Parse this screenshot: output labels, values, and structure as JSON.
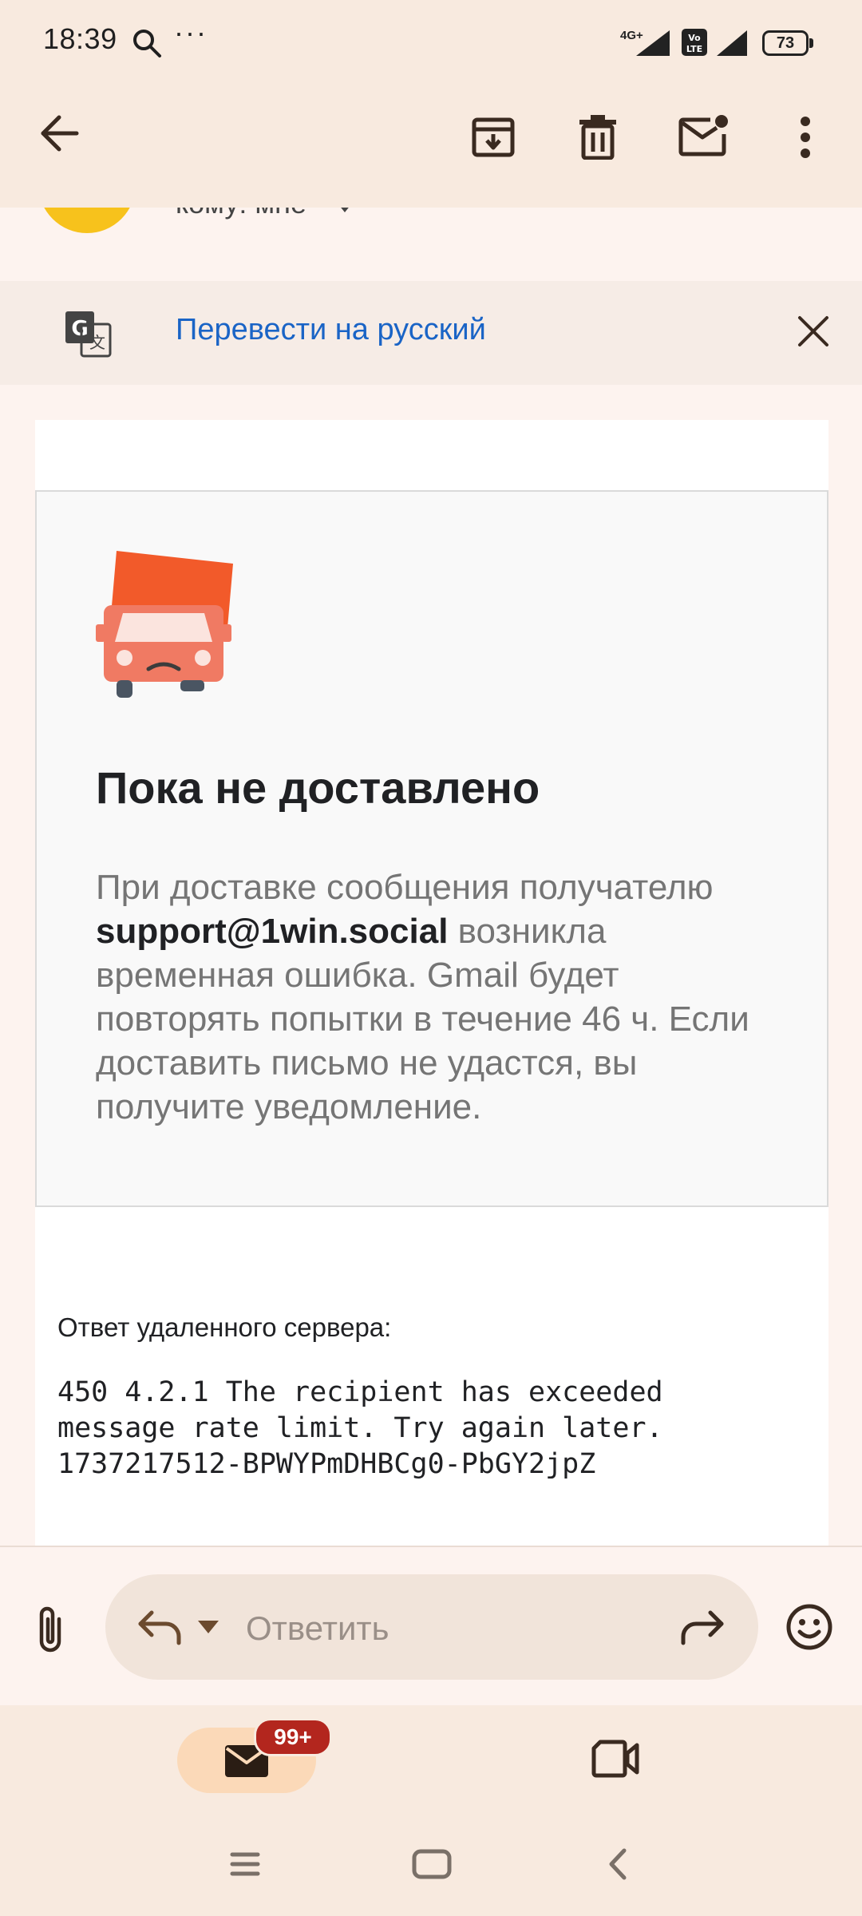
{
  "status_bar": {
    "time": "18:39",
    "dots": "···",
    "network": "4G+",
    "volte": "Vo LTE",
    "battery": "73"
  },
  "toolbar": {
    "icons": [
      "back-arrow-icon",
      "archive-icon",
      "trash-icon",
      "mark-unread-icon",
      "more-vert-icon"
    ]
  },
  "sender": {
    "recipient_label": "кому: мне"
  },
  "translate": {
    "label": "Перевести на русский"
  },
  "bounce": {
    "title": "Пока не доставлено",
    "text_before": "При доставке сообщения получателю",
    "email": "support@1win.social",
    "text_after": "возникла временная ошибка. Gmail будет повторять попытки в течение 46 ч. Если доставить письмо не удастся, вы получите уведомление."
  },
  "remote": {
    "label": "Ответ удаленного сервера:",
    "code": "450 4.2.1 The recipient has exceeded\nmessage rate limit. Try again later.\n1737217512-BPWYPmDHBCg0-PbGY2jpZ"
  },
  "reply_bar": {
    "placeholder": "Ответить"
  },
  "bottom_nav": {
    "mail_badge": "99+"
  },
  "colors": {
    "accent_link": "#1a64c6",
    "avatar": "#f7c21c",
    "badge": "#b3261e",
    "truck": "#f25a2a"
  }
}
